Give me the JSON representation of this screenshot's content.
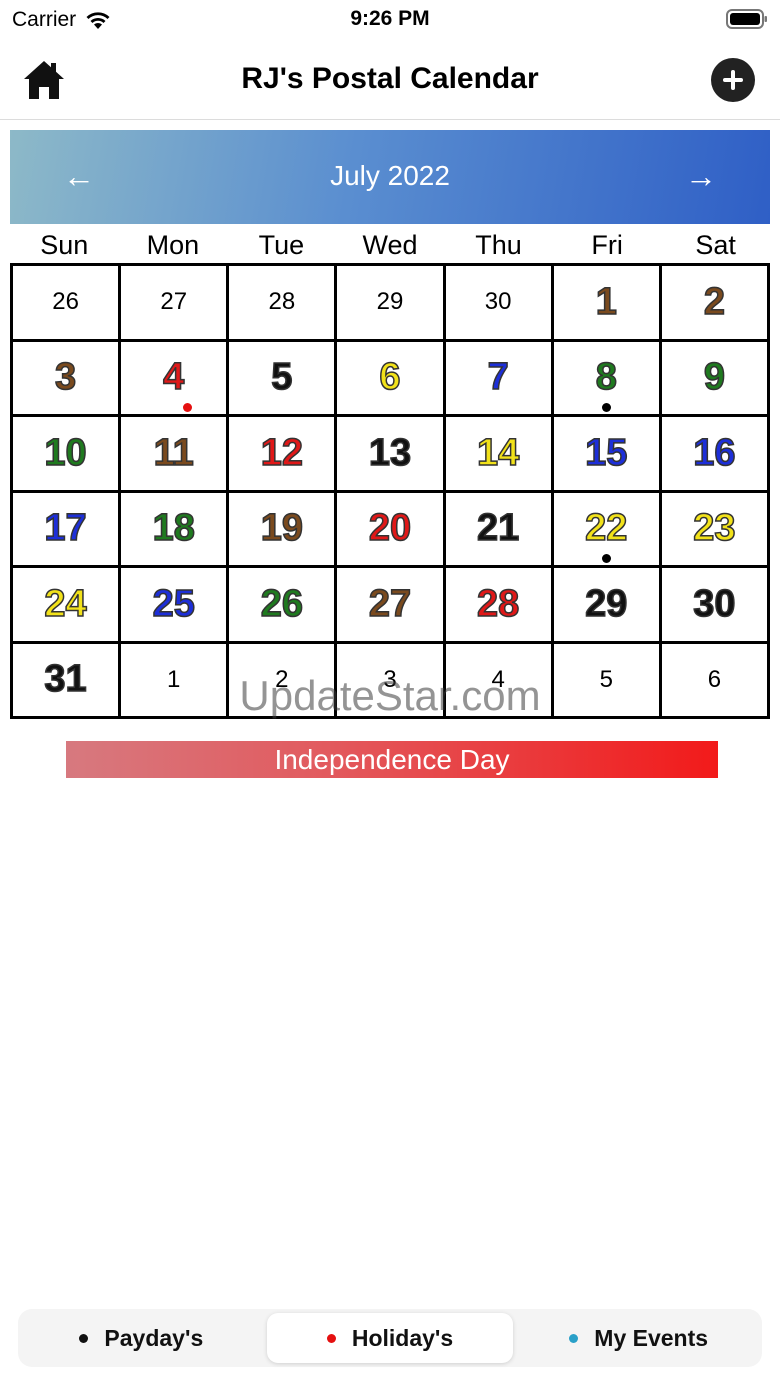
{
  "status": {
    "carrier": "Carrier",
    "time": "9:26 PM"
  },
  "nav": {
    "title": "RJ's Postal Calendar"
  },
  "month": {
    "title": "July 2022",
    "prev_glyph": "←",
    "next_glyph": "→"
  },
  "weekdays": [
    "Sun",
    "Mon",
    "Tue",
    "Wed",
    "Thu",
    "Fri",
    "Sat"
  ],
  "colors": {
    "black": "#111111",
    "brown": "#7a4a1e",
    "red": "#e01818",
    "yellow": "#f2e21a",
    "blue": "#1d2fd8",
    "green": "#1f7a1f",
    "header_gradient": [
      "#8db9c8",
      "#2f5fc6"
    ],
    "holiday_bar": [
      "#d7797f",
      "#f21a1a"
    ]
  },
  "days": [
    {
      "n": "26",
      "other": true
    },
    {
      "n": "27",
      "other": true
    },
    {
      "n": "28",
      "other": true
    },
    {
      "n": "29",
      "other": true
    },
    {
      "n": "30",
      "other": true
    },
    {
      "n": "1",
      "color": "brown"
    },
    {
      "n": "2",
      "color": "brown"
    },
    {
      "n": "3",
      "color": "brown"
    },
    {
      "n": "4",
      "color": "red",
      "dot": "red"
    },
    {
      "n": "5",
      "color": "black"
    },
    {
      "n": "6",
      "color": "yellow"
    },
    {
      "n": "7",
      "color": "blue"
    },
    {
      "n": "8",
      "color": "green",
      "dot": "black"
    },
    {
      "n": "9",
      "color": "green"
    },
    {
      "n": "10",
      "color": "green"
    },
    {
      "n": "11",
      "color": "brown"
    },
    {
      "n": "12",
      "color": "red"
    },
    {
      "n": "13",
      "color": "black"
    },
    {
      "n": "14",
      "color": "yellow"
    },
    {
      "n": "15",
      "color": "blue"
    },
    {
      "n": "16",
      "color": "blue"
    },
    {
      "n": "17",
      "color": "blue"
    },
    {
      "n": "18",
      "color": "green"
    },
    {
      "n": "19",
      "color": "brown"
    },
    {
      "n": "20",
      "color": "red"
    },
    {
      "n": "21",
      "color": "black"
    },
    {
      "n": "22",
      "color": "yellow",
      "dot": "black"
    },
    {
      "n": "23",
      "color": "yellow"
    },
    {
      "n": "24",
      "color": "yellow"
    },
    {
      "n": "25",
      "color": "blue"
    },
    {
      "n": "26",
      "color": "green"
    },
    {
      "n": "27",
      "color": "brown"
    },
    {
      "n": "28",
      "color": "red"
    },
    {
      "n": "29",
      "color": "black"
    },
    {
      "n": "30",
      "color": "black"
    },
    {
      "n": "31",
      "color": "black"
    },
    {
      "n": "1",
      "other": true
    },
    {
      "n": "2",
      "other": true
    },
    {
      "n": "3",
      "other": true
    },
    {
      "n": "4",
      "other": true
    },
    {
      "n": "5",
      "other": true
    },
    {
      "n": "6",
      "other": true
    }
  ],
  "watermark": "UpdateStar.com",
  "event": {
    "label": "Independence Day"
  },
  "segments": [
    {
      "label": "Payday's",
      "dot_color": "#111111",
      "active": false
    },
    {
      "label": "Holiday's",
      "dot_color": "#e51010",
      "active": true
    },
    {
      "label": "My Events",
      "dot_color": "#2aa0c8",
      "active": false
    }
  ]
}
